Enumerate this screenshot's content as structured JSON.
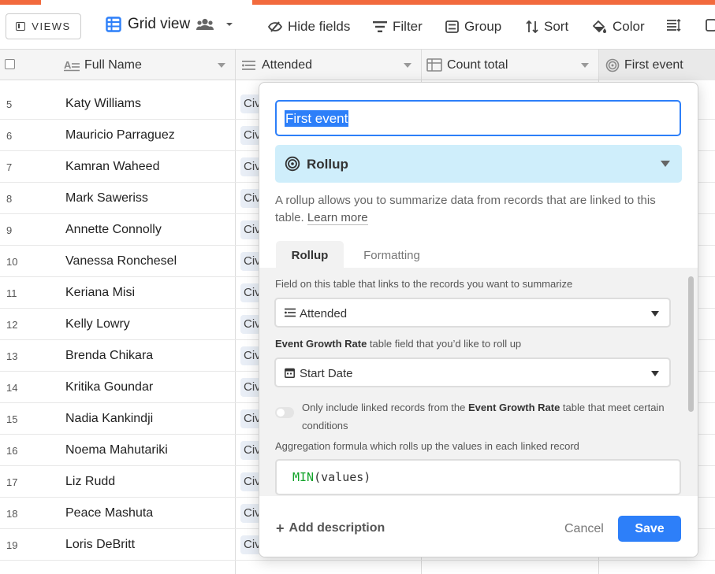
{
  "toolbar": {
    "views_label": "VIEWS",
    "view_name": "Grid view",
    "hide_fields": "Hide fields",
    "filter": "Filter",
    "group": "Group",
    "sort": "Sort",
    "color": "Color"
  },
  "columns": {
    "full_name": "Full Name",
    "attended": "Attended",
    "count_total": "Count total",
    "first_event": "First event"
  },
  "rows": [
    {
      "num": "5",
      "name": "Katy Williams",
      "chip": "Civ"
    },
    {
      "num": "6",
      "name": "Mauricio Parraguez",
      "chip": "Civ"
    },
    {
      "num": "7",
      "name": "Kamran Waheed",
      "chip": "Civ"
    },
    {
      "num": "8",
      "name": "Mark Saweriss",
      "chip": "Civ"
    },
    {
      "num": "9",
      "name": "Annette Connolly",
      "chip": "Civ"
    },
    {
      "num": "10",
      "name": "Vanessa Ronchesel",
      "chip": "Civ"
    },
    {
      "num": "11",
      "name": "Keriana Misi",
      "chip": "Civ"
    },
    {
      "num": "12",
      "name": "Kelly Lowry",
      "chip": "Civ"
    },
    {
      "num": "13",
      "name": "Brenda Chikara",
      "chip": "Civ"
    },
    {
      "num": "14",
      "name": "Kritika Goundar",
      "chip": "Civ"
    },
    {
      "num": "15",
      "name": "Nadia Kankindji",
      "chip": "Civ"
    },
    {
      "num": "16",
      "name": "Noema Mahutariki",
      "chip": "Civ"
    },
    {
      "num": "17",
      "name": "Liz Rudd",
      "chip": "Civ"
    },
    {
      "num": "18",
      "name": "Peace Mashuta",
      "chip": "Civ"
    },
    {
      "num": "19",
      "name": "Loris DeBritt",
      "chip": "Civ"
    }
  ],
  "dialog": {
    "field_name": "First event",
    "field_type": "Rollup",
    "description": "A rollup allows you to summarize data from records that are linked to this table.",
    "learn_more": "Learn more",
    "tabs": [
      "Rollup",
      "Formatting"
    ],
    "link_field_label": "Field on this table that links to the records you want to summarize",
    "link_field_value": "Attended",
    "rollup_table": "Event Growth Rate",
    "rollup_field_label_suffix": "table field that you’d like to roll up",
    "rollup_field_value": "Start Date",
    "condition_prefix": "Only include linked records from the",
    "condition_table": "Event Growth Rate",
    "condition_suffix": "table that meet certain conditions",
    "aggregation_label": "Aggregation formula which rolls up the values in each linked record",
    "formula_fn": "MIN",
    "formula_args": "(values)",
    "add_description": "Add description",
    "cancel": "Cancel",
    "save": "Save"
  },
  "colors": {
    "accent": "#f26a3d",
    "primary": "#2d7ff9",
    "rollup_bg": "#cfeefb"
  }
}
